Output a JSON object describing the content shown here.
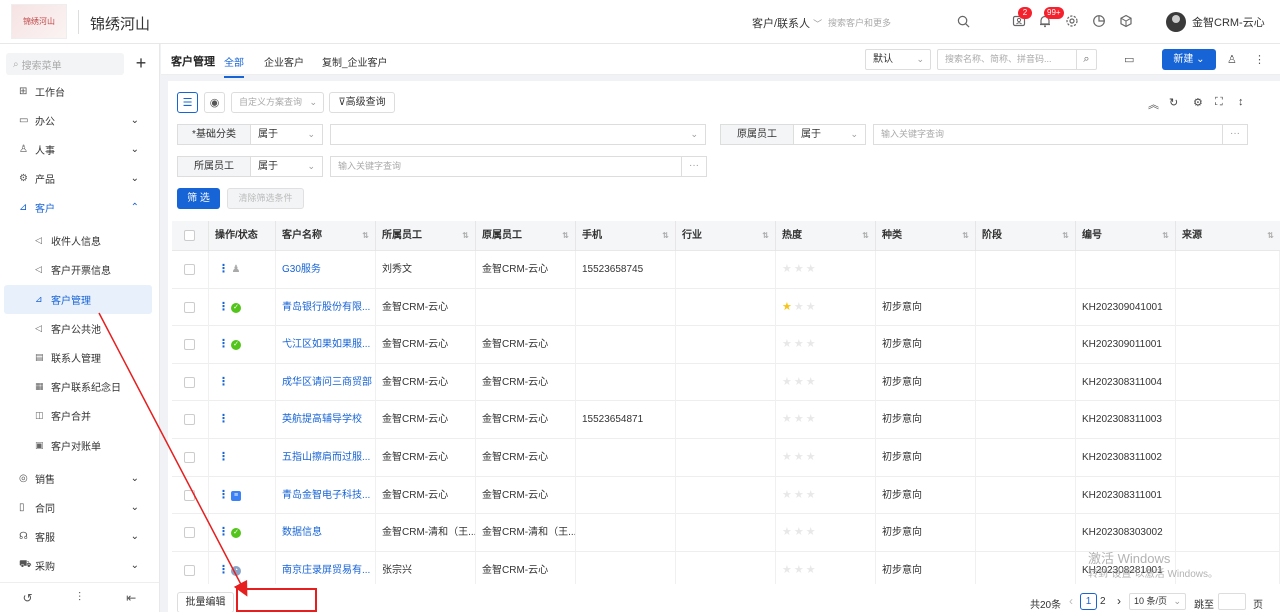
{
  "header": {
    "logo_text": "锦绣河山",
    "company_name": "锦绣河山",
    "scope_label": "客户/联系人",
    "search_placeholder": "搜索客户和更多",
    "notifications": [
      {
        "icon": "contact-card-icon",
        "count": "2"
      },
      {
        "icon": "bell-icon",
        "count": "99+"
      }
    ],
    "user_name": "金智CRM-云心"
  },
  "sidebar": {
    "search_placeholder": "搜索菜单",
    "add_label": "+",
    "items": [
      {
        "label": "工作台",
        "icon": "dashboard-icon"
      },
      {
        "label": "办公",
        "icon": "office-icon"
      },
      {
        "label": "人事",
        "icon": "people-icon"
      },
      {
        "label": "产品",
        "icon": "product-icon"
      },
      {
        "label": "客户",
        "icon": "customer-icon"
      },
      {
        "label": "销售",
        "icon": "sales-icon"
      },
      {
        "label": "合同",
        "icon": "contract-icon"
      },
      {
        "label": "客服",
        "icon": "service-icon"
      },
      {
        "label": "采购",
        "icon": "purchase-icon"
      }
    ],
    "sub_items": [
      {
        "label": "收件人信息"
      },
      {
        "label": "客户开票信息"
      },
      {
        "label": "客户管理"
      },
      {
        "label": "客户公共池"
      },
      {
        "label": "联系人管理"
      },
      {
        "label": "客户联系纪念日"
      },
      {
        "label": "客户合并"
      },
      {
        "label": "客户对账单"
      }
    ]
  },
  "tabs": {
    "title": "客户管理",
    "items": [
      "全部",
      "企业客户",
      "复制_企业客户"
    ],
    "view_select": "默认",
    "keyword_placeholder": "搜索名称、简称、拼音码...",
    "new_button": "新建"
  },
  "toolbar": {
    "scheme_placeholder": "自定义方案查询",
    "advanced_query": "高级查询"
  },
  "filters": {
    "basic_category_label": "*基础分类",
    "basic_category_op": "属于",
    "original_staff_label": "原属员工",
    "original_staff_op": "属于",
    "original_staff_placeholder": "输入关键字查询",
    "staff_label": "所属员工",
    "staff_op": "属于",
    "staff_placeholder": "输入关键字查询",
    "more": "···",
    "filter_button": "筛 选",
    "clear_button": "清除筛选条件"
  },
  "table": {
    "columns": [
      "操作/状态",
      "客户名称",
      "所属员工",
      "原属员工",
      "手机",
      "行业",
      "热度",
      "种类",
      "阶段",
      "编号",
      "来源"
    ],
    "rows": [
      {
        "status": "user",
        "name": "G30服务",
        "staff": "刘秀文",
        "orig": "金智CRM-云心",
        "phone": "15523658745",
        "industry": "",
        "heat": 0,
        "kind": "",
        "stage": "",
        "code": ""
      },
      {
        "status": "ok",
        "name": "青岛银行股份有限...",
        "staff": "金智CRM-云心",
        "orig": "",
        "phone": "",
        "industry": "",
        "heat": 1,
        "kind": "初步意向",
        "stage": "",
        "code": "KH202309041001"
      },
      {
        "status": "ok",
        "name": "弋江区如果如果服...",
        "staff": "金智CRM-云心",
        "orig": "金智CRM-云心",
        "phone": "",
        "industry": "",
        "heat": 0,
        "kind": "初步意向",
        "stage": "",
        "code": "KH202309011001"
      },
      {
        "status": "",
        "name": "成华区请问三商贸部",
        "staff": "金智CRM-云心",
        "orig": "金智CRM-云心",
        "phone": "",
        "industry": "",
        "heat": 0,
        "kind": "初步意向",
        "stage": "",
        "code": "KH202308311004"
      },
      {
        "status": "",
        "name": "英航提高辅导学校",
        "staff": "金智CRM-云心",
        "orig": "金智CRM-云心",
        "phone": "15523654871",
        "industry": "",
        "heat": 0,
        "kind": "初步意向",
        "stage": "",
        "code": "KH202308311003"
      },
      {
        "status": "",
        "name": "五指山擦肩而过服...",
        "staff": "金智CRM-云心",
        "orig": "金智CRM-云心",
        "phone": "",
        "industry": "",
        "heat": 0,
        "kind": "初步意向",
        "stage": "",
        "code": "KH202308311002"
      },
      {
        "status": "doc",
        "name": "青岛金智电子科技...",
        "staff": "金智CRM-云心",
        "orig": "金智CRM-云心",
        "phone": "",
        "industry": "",
        "heat": 0,
        "kind": "初步意向",
        "stage": "",
        "code": "KH202308311001"
      },
      {
        "status": "ok",
        "name": "数据信息",
        "staff": "金智CRM-清和（王...",
        "orig": "金智CRM-清和（王...",
        "phone": "",
        "industry": "",
        "heat": 0,
        "kind": "初步意向",
        "stage": "",
        "code": "KH202308303002"
      },
      {
        "status": "g",
        "name": "南京庄录屏贸易有...",
        "staff": "张宗兴",
        "orig": "金智CRM-云心",
        "phone": "",
        "industry": "",
        "heat": 0,
        "kind": "初步意向",
        "stage": "",
        "code": "KH202308281001"
      }
    ]
  },
  "footer": {
    "batch_edit": "批量编辑",
    "total": "共20条",
    "prev": "‹",
    "pages": [
      "1",
      "2"
    ],
    "next": "›",
    "page_size": "10 条/页",
    "goto": "跳至",
    "page_unit": "页"
  },
  "watermark": {
    "line1": "激活 Windows",
    "line2": "转到“设置”以激活 Windows。"
  },
  "colors": {
    "primary": "#1764d6",
    "annotation": "#e61e1e",
    "star": "#f5c518"
  }
}
